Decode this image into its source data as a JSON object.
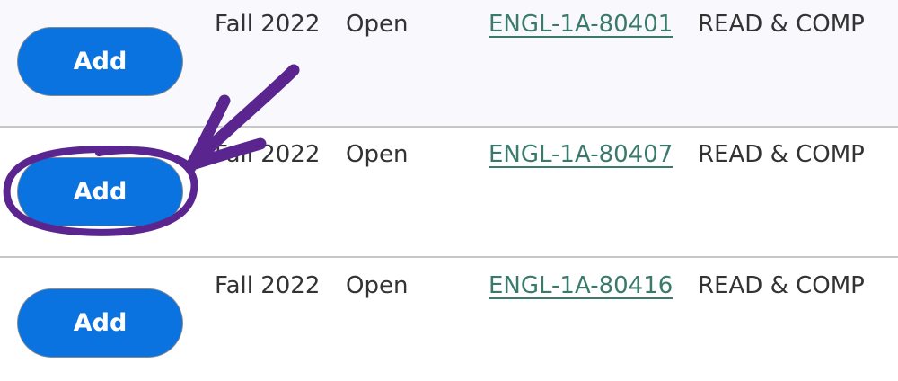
{
  "sections": [
    {
      "add_label": "Add",
      "term": "Fall 2022",
      "status": "Open",
      "course_code": "ENGL-1A-80401",
      "course_title": "READ & COMP"
    },
    {
      "add_label": "Add",
      "term": "Fall 2022",
      "status": "Open",
      "course_code": "ENGL-1A-80407",
      "course_title": "READ & COMP"
    },
    {
      "add_label": "Add",
      "term": "Fall 2022",
      "status": "Open",
      "course_code": "ENGL-1A-80416",
      "course_title": "READ & COMP"
    }
  ],
  "colors": {
    "button_blue": "#0b73e0",
    "link_green": "#3a7a6c",
    "annotation_purple": "#5b2590",
    "row_alt_bg": "#f8f8fd"
  },
  "icons": {
    "annotation_arrow": "hand-drawn-arrow-icon",
    "annotation_circle": "hand-drawn-circle-icon"
  }
}
